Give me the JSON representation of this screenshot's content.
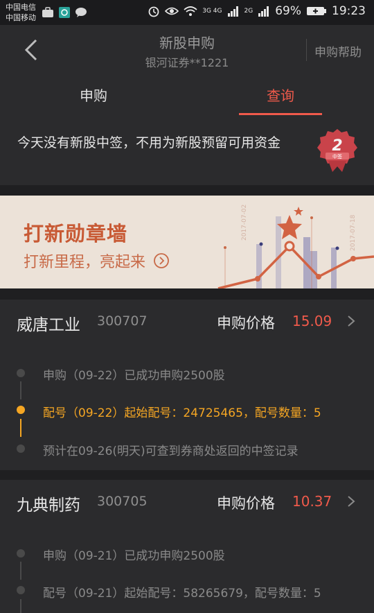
{
  "status_bar": {
    "carrier1": "中国电信",
    "carrier2": "中国移动",
    "network1": "3G 4G",
    "network2": "2G",
    "battery": "69%",
    "time": "19:23"
  },
  "header": {
    "title": "新股申购",
    "subtitle": "银河证券**1221",
    "help": "申购帮助"
  },
  "tabs": [
    {
      "label": "申购",
      "active": false
    },
    {
      "label": "查询",
      "active": true
    }
  ],
  "notice": {
    "text": "今天没有新股中签，不用为新股预留可用资金",
    "badge_number": "2",
    "badge_label": "中签"
  },
  "banner": {
    "title": "打新勋章墙",
    "subtitle": "打新里程，亮起来",
    "date1": "2017-07-02",
    "date2": "2017-07-18"
  },
  "stocks": [
    {
      "name": "威唐工业",
      "code": "300707",
      "price_label": "申购价格",
      "price": "15.09",
      "steps": [
        {
          "text": "申购（09-22）已成功申购2500股",
          "active": false
        },
        {
          "text": "配号（09-22）起始配号：24725465，配号数量：5",
          "active": true
        },
        {
          "text": "预计在09-26(明天)可查到券商处返回的中签记录",
          "active": false
        }
      ]
    },
    {
      "name": "九典制药",
      "code": "300705",
      "price_label": "申购价格",
      "price": "10.37",
      "steps": [
        {
          "text": "申购（09-21）已成功申购2500股",
          "active": false
        },
        {
          "text": "配号（09-21）起始配号：58265679，配号数量：5",
          "active": false
        }
      ]
    }
  ],
  "colors": {
    "accent": "#f05a4b",
    "active_step": "#f5a623",
    "background": "#1f1f21",
    "card": "#2b2b2d"
  }
}
